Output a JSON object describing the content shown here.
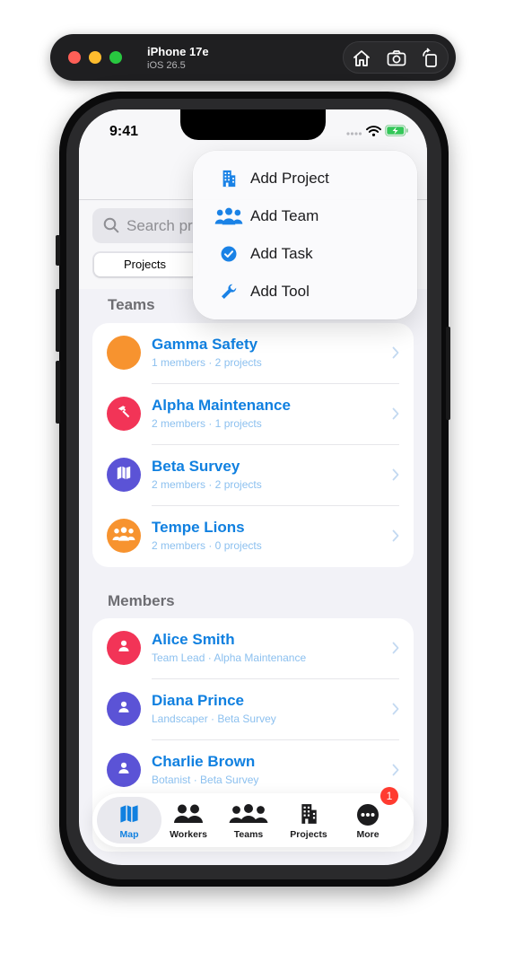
{
  "simulator": {
    "device_name": "iPhone 17e",
    "os_version": "iOS 26.5",
    "buttons": [
      "home-icon",
      "screenshot-icon",
      "rotate-icon"
    ]
  },
  "status_bar": {
    "time": "9:41",
    "icons": [
      "cellular-dots-icon",
      "wifi-icon",
      "battery-charging-icon"
    ]
  },
  "search": {
    "placeholder": "Search pr"
  },
  "segmented": {
    "selected_label": "Projects"
  },
  "sections": {
    "teams_title": "Teams",
    "members_title": "Members"
  },
  "teams": [
    {
      "name": "Gamma Safety",
      "subtitle": "1 members · 2 projects",
      "color": "#f7932f",
      "icon": ""
    },
    {
      "name": "Alpha Maintenance",
      "subtitle": "2 members · 1 projects",
      "color": "#f23457",
      "icon": "hammer-icon"
    },
    {
      "name": "Beta Survey",
      "subtitle": "2 members · 2 projects",
      "color": "#5b53d6",
      "icon": "map-icon"
    },
    {
      "name": "Tempe Lions",
      "subtitle": "2 members · 0 projects",
      "color": "#f7932f",
      "icon": "people-icon"
    }
  ],
  "members": [
    {
      "name": "Alice Smith",
      "subtitle": "Team Lead · Alpha Maintenance",
      "color": "#f23457",
      "icon": "person-icon"
    },
    {
      "name": "Diana Prince",
      "subtitle": "Landscaper · Beta Survey",
      "color": "#5b53d6",
      "icon": "person-icon"
    },
    {
      "name": "Charlie Brown",
      "subtitle": "Botanist · Beta Survey",
      "color": "#5b53d6",
      "icon": "person-icon"
    }
  ],
  "menu": {
    "items": [
      {
        "label": "Add Project",
        "icon": "building-icon"
      },
      {
        "label": "Add Team",
        "icon": "people-icon"
      },
      {
        "label": "Add Task",
        "icon": "checkmark-circle-icon"
      },
      {
        "label": "Add Tool",
        "icon": "wrench-icon"
      }
    ]
  },
  "tabbar": {
    "tabs": [
      {
        "label": "Map",
        "icon": "map-icon",
        "active": true
      },
      {
        "label": "Workers",
        "icon": "person-2-icon"
      },
      {
        "label": "Teams",
        "icon": "person-3-icon"
      },
      {
        "label": "Projects",
        "icon": "building-icon"
      },
      {
        "label": "More",
        "icon": "ellipsis-circle-icon"
      }
    ],
    "more_badge": "1"
  },
  "colors": {
    "accent": "#1080e0",
    "menu_icon": "#1a82e6",
    "background": "#f2f2f7"
  }
}
